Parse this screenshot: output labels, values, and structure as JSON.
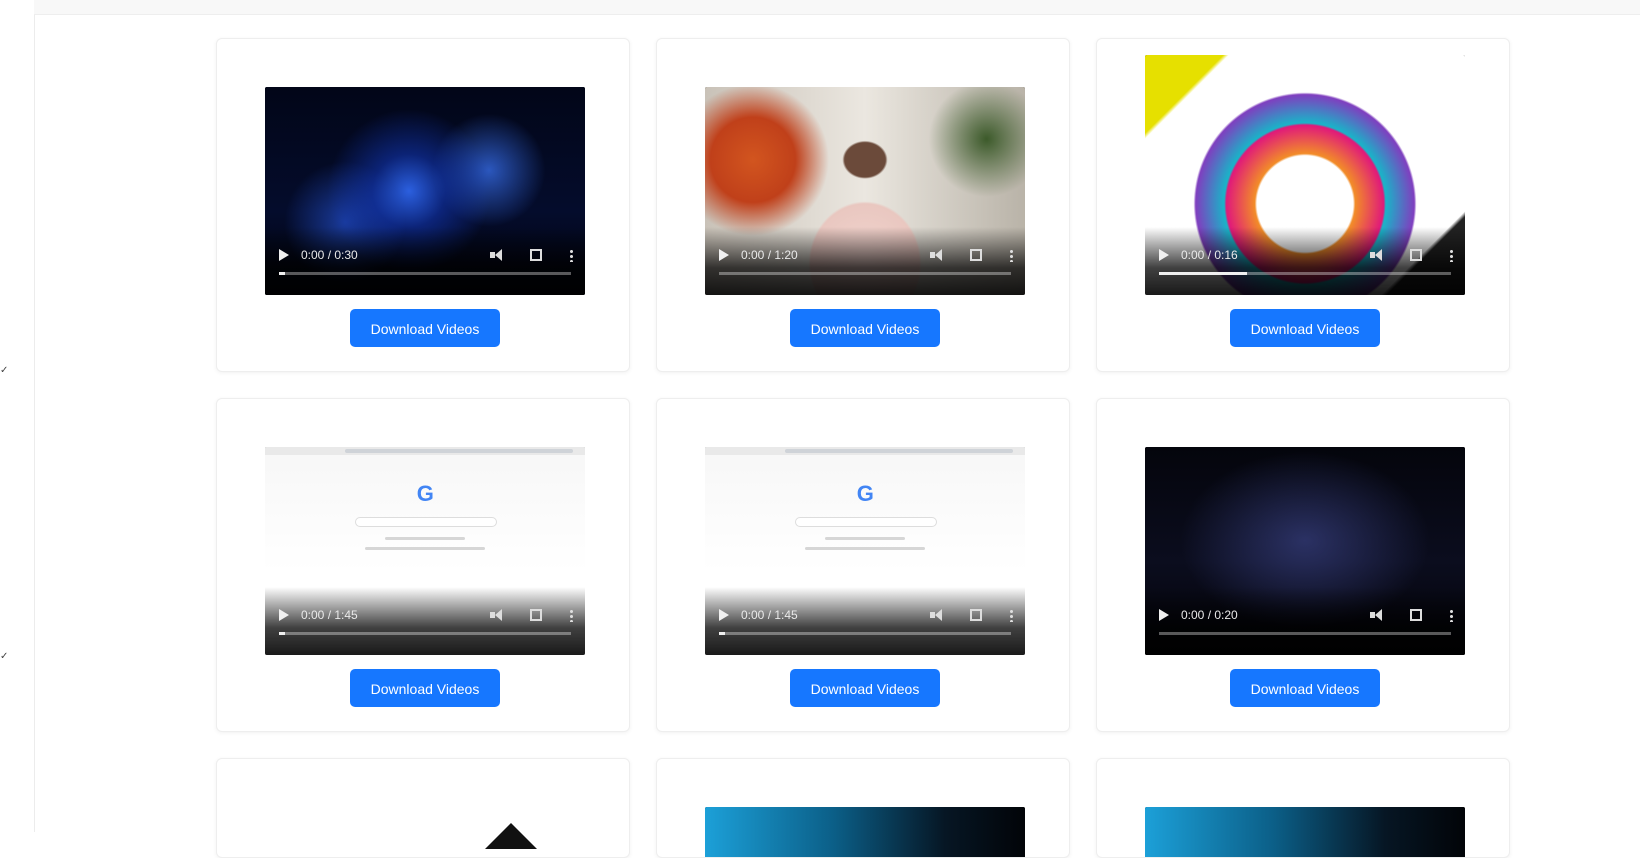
{
  "videos": [
    {
      "thumbnail": "space-particles",
      "time": "0:00 / 0:30",
      "progress": 0.02,
      "button_label": "Download Videos"
    },
    {
      "thumbnail": "presenter-in-room",
      "time": "0:00 / 1:20",
      "progress": 0.0,
      "button_label": "Download Videos"
    },
    {
      "thumbnail": "digital-marketing-wheel",
      "time": "0:00 / 0:16",
      "progress": 0.3,
      "button_label": "Download Videos"
    },
    {
      "thumbnail": "google-homepage",
      "time": "0:00 / 1:45",
      "progress": 0.02,
      "button_label": "Download Videos"
    },
    {
      "thumbnail": "google-homepage",
      "time": "0:00 / 1:45",
      "progress": 0.02,
      "button_label": "Download Videos"
    },
    {
      "thumbnail": "dark-space",
      "time": "0:00 / 0:20",
      "progress": 0.0,
      "button_label": "Download Videos"
    },
    {
      "thumbnail": "white-with-shape",
      "time": "",
      "progress": 0.0,
      "button_label": ""
    },
    {
      "thumbnail": "cyan-gradient",
      "time": "",
      "progress": 0.0,
      "button_label": ""
    },
    {
      "thumbnail": "cyan-gradient",
      "time": "",
      "progress": 0.0,
      "button_label": ""
    }
  ],
  "colors": {
    "button": "#1677ff",
    "page_background": "#ffffff"
  }
}
